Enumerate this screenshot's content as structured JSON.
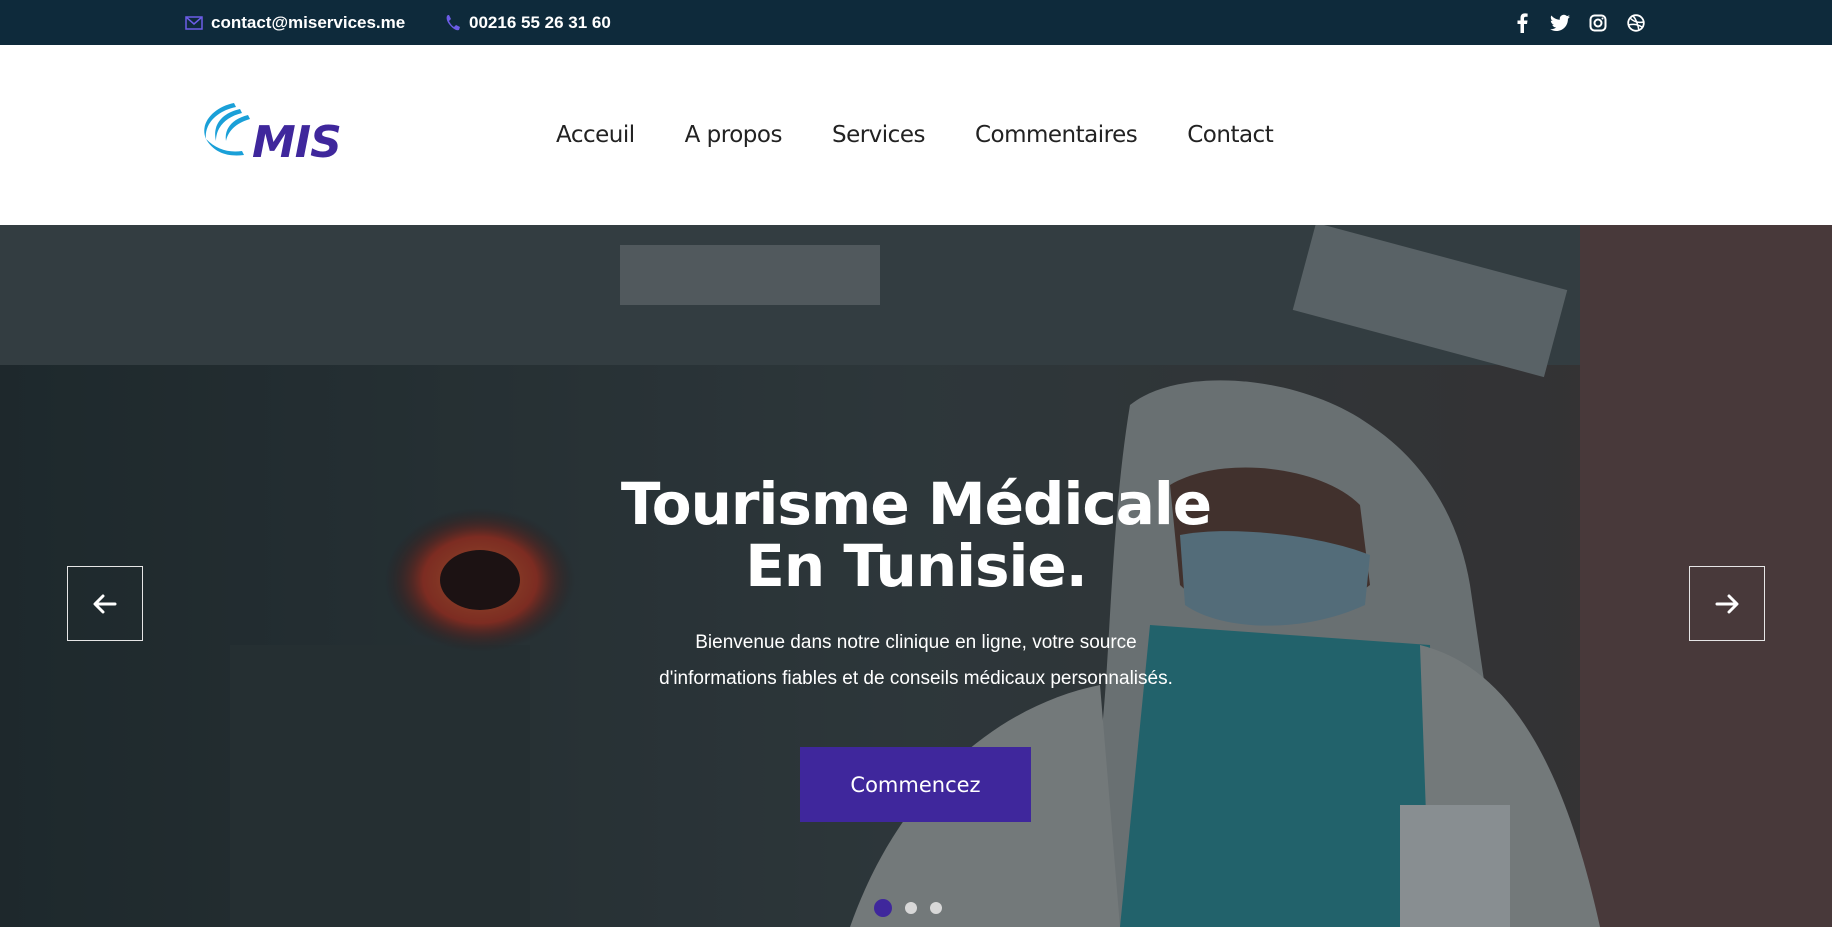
{
  "topbar": {
    "email": "contact@miservices.me",
    "phone": "00216 55 26 31 60",
    "socials": [
      "facebook-icon",
      "twitter-icon",
      "instagram-icon",
      "dribbble-icon"
    ]
  },
  "header": {
    "logo_text": "MIS",
    "nav": [
      "Acceuil",
      "A propos",
      "Services",
      "Commentaires",
      "Contact"
    ]
  },
  "hero": {
    "title_line1": "Tourisme Médicale",
    "title_line2": "En Tunisie.",
    "subtitle_line1": "Bienvenue dans notre clinique en ligne, votre source",
    "subtitle_line2": "d'informations fiables et de conseils médicaux personnalisés.",
    "cta": "Commencez",
    "slides_total": 3,
    "active_slide": 1
  },
  "colors": {
    "topbar_bg": "#0e2a3b",
    "accent": "#3f279c",
    "logo_blue": "#1aa0d8"
  }
}
